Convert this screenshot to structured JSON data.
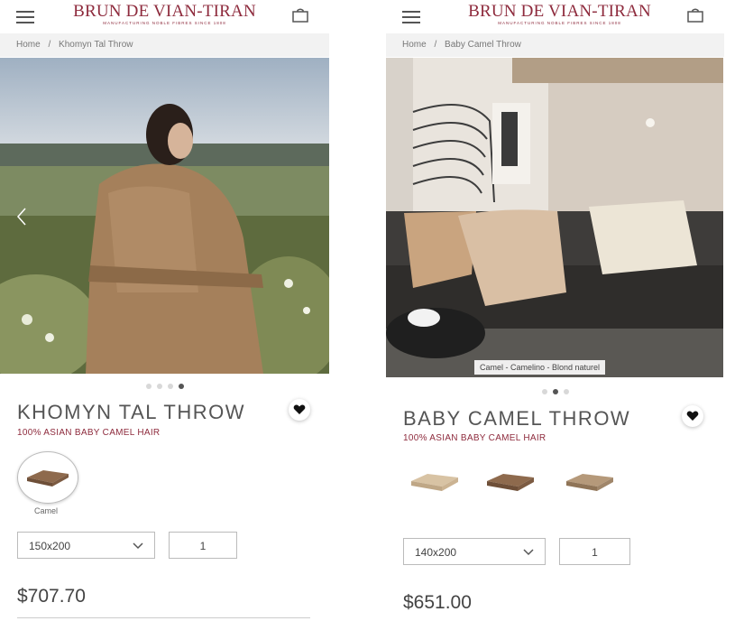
{
  "brand": {
    "name": "BRUN DE VIAN-TIRAN",
    "tagline": "MANUFACTURING NOBLE FIBRES SINCE 1808"
  },
  "left": {
    "breadcrumb": {
      "home": "Home",
      "sep": "/",
      "current": "Khomyn Tal Throw"
    },
    "slides": {
      "count": 4,
      "active": 3
    },
    "title": "KHOMYN TAL THROW",
    "subtitle": "100% ASIAN BABY CAMEL HAIR",
    "swatch_label": "Camel",
    "size": "150x200",
    "quantity": "1",
    "price": "$707.70"
  },
  "right": {
    "breadcrumb": {
      "home": "Home",
      "sep": "/",
      "current": "Baby Camel Throw"
    },
    "image_caption": "Camel - Camelino - Blond naturel",
    "slides": {
      "count": 3,
      "active": 1
    },
    "title": "BABY CAMEL THROW",
    "subtitle": "100% ASIAN BABY CAMEL HAIR",
    "size": "140x200",
    "quantity": "1",
    "price": "$651.00"
  },
  "icons": {
    "menu": "menu-icon",
    "bag": "shopping-bag-icon",
    "heart": "heart-icon",
    "chevron": "chevron-down-icon",
    "prev": "chevron-left-icon"
  },
  "colors": {
    "brand": "#8e2b3d",
    "crumb_bg": "#f2f2f2",
    "text": "#555555"
  }
}
